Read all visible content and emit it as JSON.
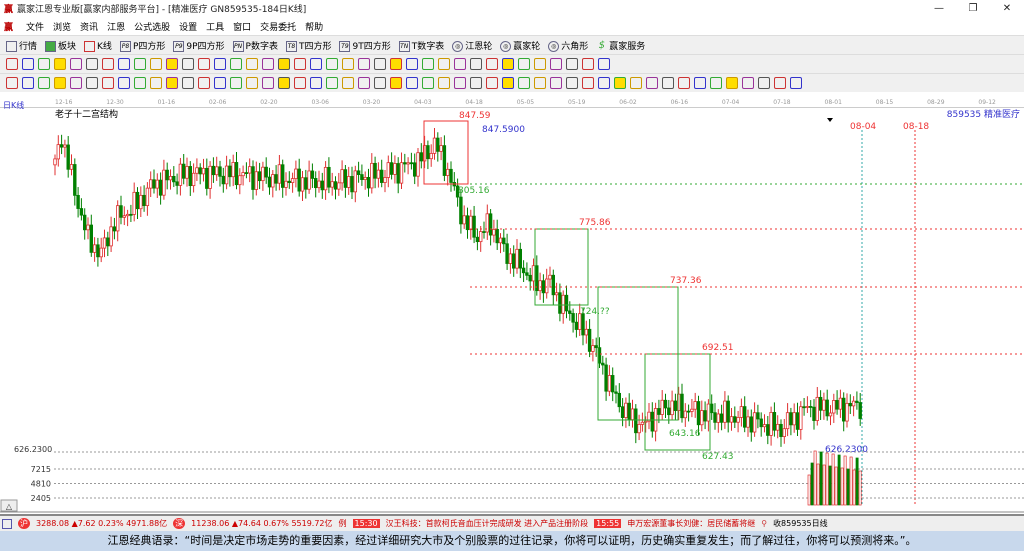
{
  "window": {
    "title": "赢家江恩专业版[赢家内部服务平台] - [精准医疗  GN859535-184日K线]",
    "controls": [
      "—",
      "❐",
      "✕"
    ]
  },
  "menu": [
    "文件",
    "浏览",
    "资讯",
    "江恩",
    "公式选股",
    "设置",
    "工具",
    "窗口",
    "交易委托",
    "帮助"
  ],
  "toolbar": [
    "行情",
    "板块",
    "K线",
    "P四方形",
    "9P四方形",
    "P数字表",
    "T四方形",
    "9T四方形",
    "T数字表",
    "江恩轮",
    "赢家轮",
    "六角形",
    "赢家服务"
  ],
  "toolbar_icons": [
    "P8",
    "P9",
    "PN",
    "T8",
    "T9",
    "TN",
    "◎",
    "◎",
    "◎",
    "$"
  ],
  "period": "日K线",
  "chart_title": "老子十二宫结构",
  "stock": "859535 精准医疗",
  "dates": [
    "12-16",
    "12-30",
    "01-16",
    "02-06",
    "02-20",
    "03-06",
    "03-20",
    "04-03",
    "04-18",
    "05-05",
    "05-19",
    "06-02",
    "06-16",
    "07-04",
    "07-18",
    "08-01",
    "08-15",
    "08-29",
    "09-12"
  ],
  "future_dates": [
    "08-04",
    "08-18"
  ],
  "levels": {
    "high": "847.59",
    "high_blue": "847.5900",
    "l1": "805.16",
    "l2": "775.86",
    "l3": "724.??",
    "l4": "737.36",
    "l5": "692.51",
    "l6": "643.16",
    "l7": "627.43",
    "low": "626.2300"
  },
  "axis": {
    "price": "626.2300",
    "vol": [
      "7215",
      "4810",
      "2405"
    ],
    "toggle": "△"
  },
  "price_path": [
    [
      0,
      818
    ],
    [
      2,
      838
    ],
    [
      6,
      800
    ],
    [
      10,
      768
    ],
    [
      14,
      758
    ],
    [
      18,
      780
    ],
    [
      24,
      790
    ],
    [
      30,
      805
    ],
    [
      40,
      812
    ],
    [
      55,
      812
    ],
    [
      70,
      808
    ],
    [
      85,
      806
    ],
    [
      100,
      812
    ],
    [
      110,
      820
    ],
    [
      115,
      832
    ],
    [
      118,
      820
    ],
    [
      121,
      800
    ],
    [
      124,
      780
    ],
    [
      128,
      770
    ],
    [
      132,
      778
    ],
    [
      136,
      760
    ],
    [
      140,
      752
    ],
    [
      146,
      738
    ],
    [
      150,
      738
    ],
    [
      154,
      722
    ],
    [
      158,
      712
    ],
    [
      162,
      700
    ],
    [
      166,
      680
    ],
    [
      170,
      660
    ],
    [
      174,
      648
    ],
    [
      178,
      642
    ],
    [
      182,
      650
    ],
    [
      186,
      656
    ],
    [
      196,
      650
    ],
    [
      206,
      648
    ],
    [
      213,
      644
    ],
    [
      220,
      640
    ],
    [
      228,
      654
    ],
    [
      236,
      654
    ],
    [
      246,
      656
    ]
  ],
  "status": {
    "sh": "沪",
    "sh_text": "3288.08 ▲7.62 0.23% 4971.88亿",
    "sz": "深",
    "sz_text": "11238.06 ▲74.64 0.67% 5519.72亿",
    "prefix": "例",
    "time1": "15:30",
    "news1": "汉王科技：首款柯氏音血压计完成研发 进入产品注册阶段",
    "time2": "15:55",
    "news2": "申万宏源董事长刘健：居民储蓄将继",
    "code": "收859535日线"
  },
  "quote": "江恩经典语录：“时间是决定市场走势的重要因素，经过详细研究大市及个别股票的过往记录，你将可以证明，历史确实重复发生；而了解过往，你将可以预测将来。”。",
  "colors": {
    "up": "#e03030",
    "down": "#008000",
    "blue": "#3333cc"
  }
}
